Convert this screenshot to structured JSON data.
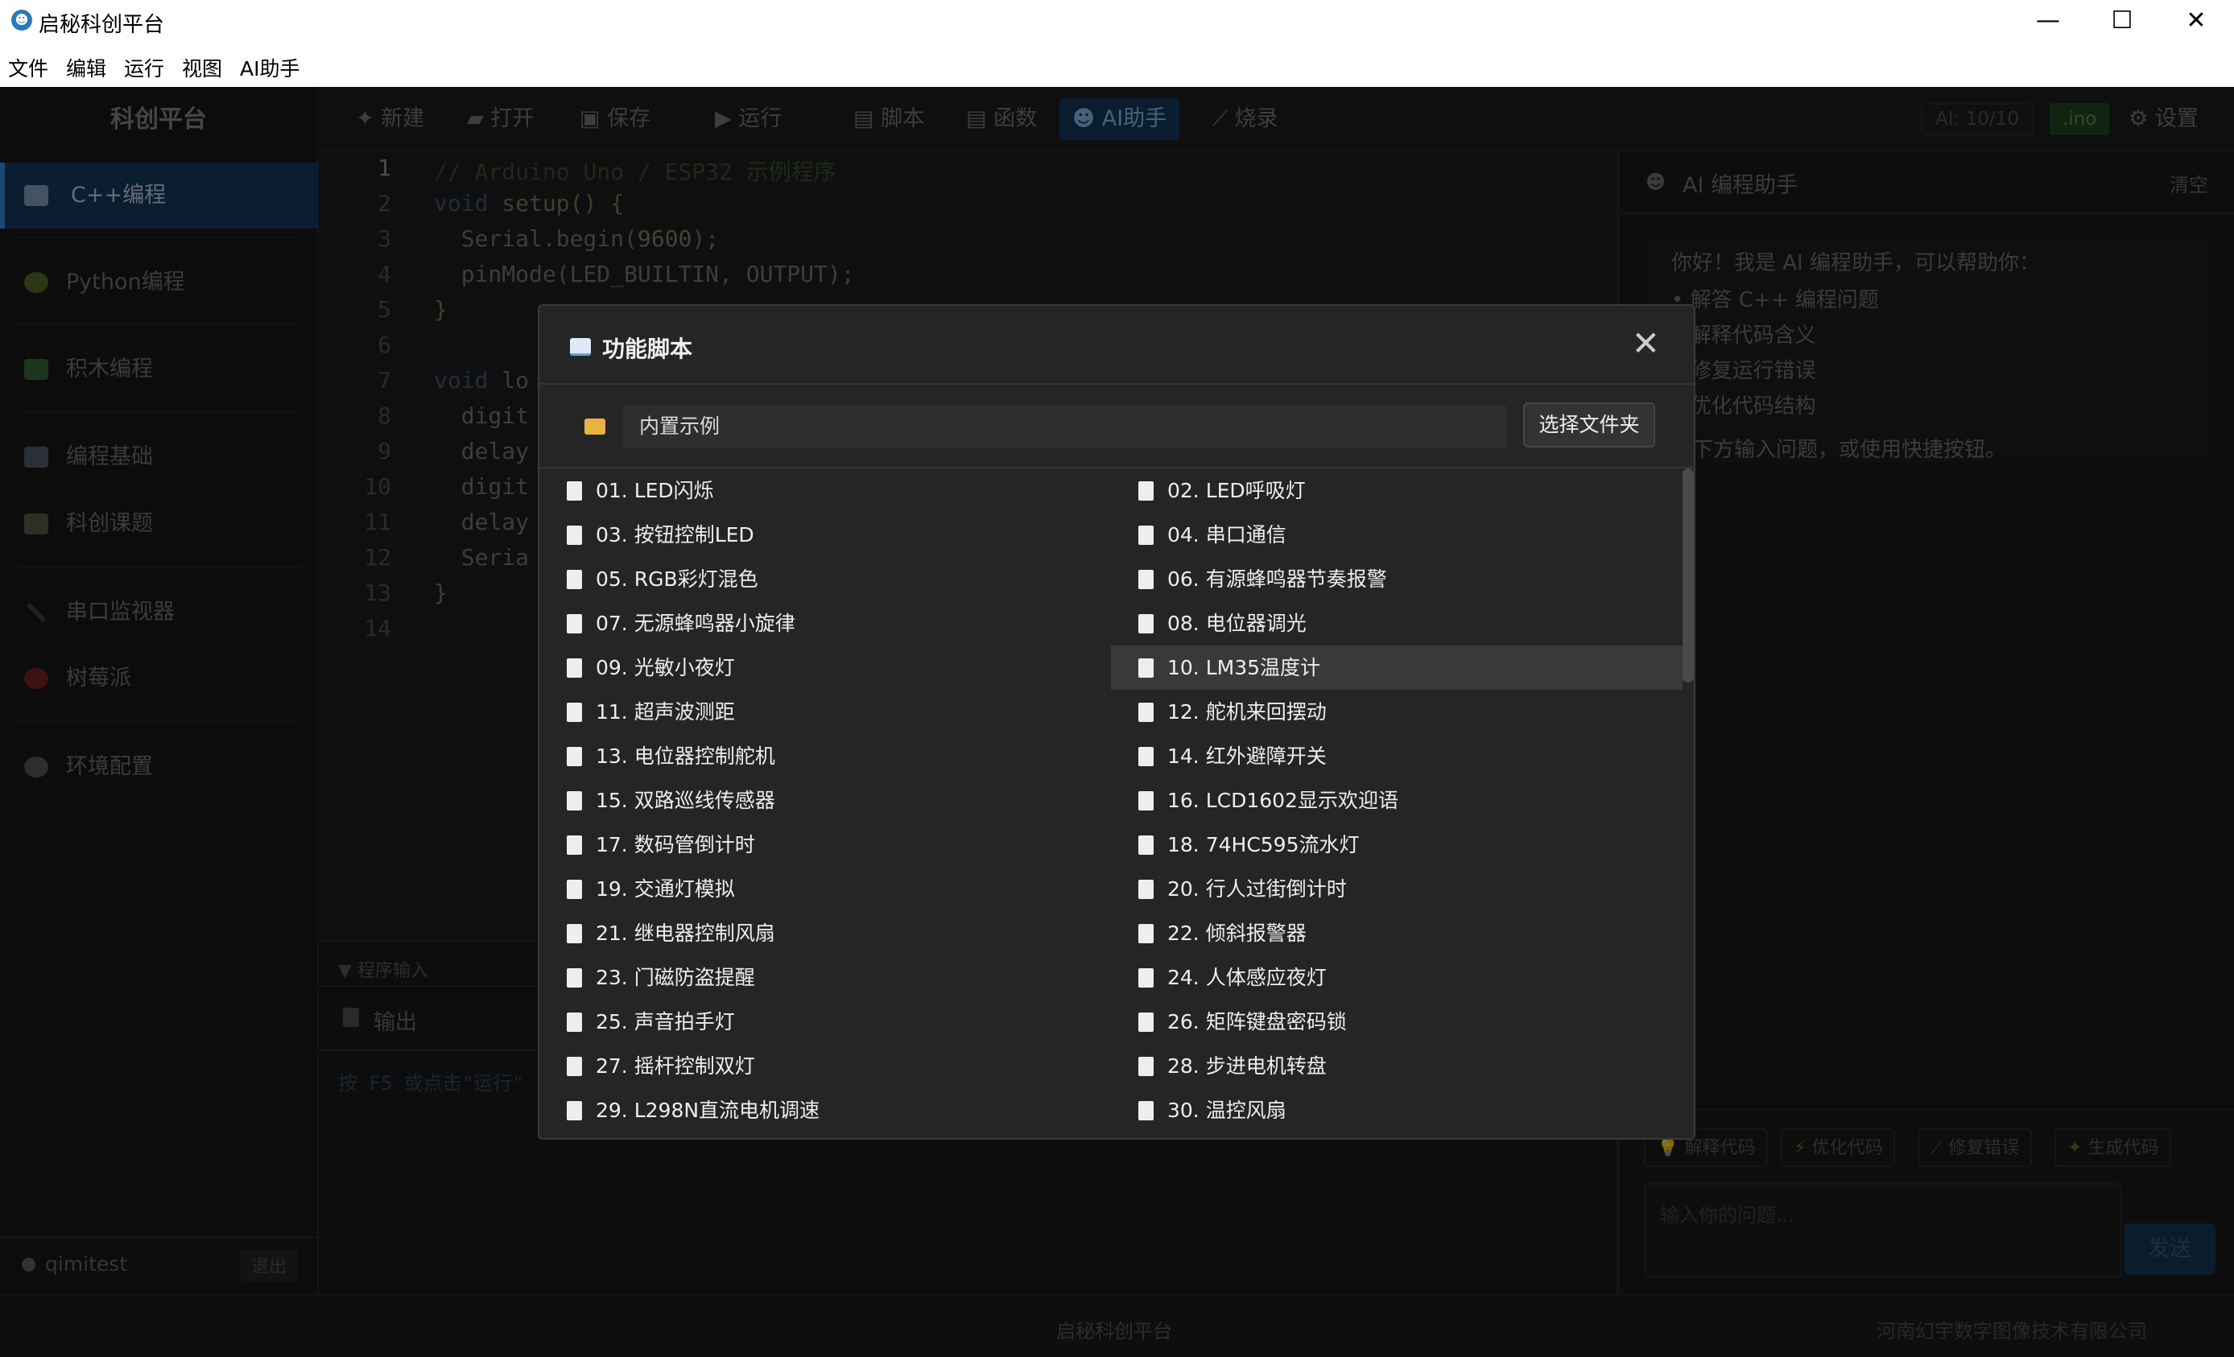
{
  "window": {
    "title": "启秘科创平台",
    "minimize": "—",
    "maximize": "☐",
    "close": "✕"
  },
  "menu": [
    "文件",
    "编辑",
    "运行",
    "视图",
    "AI助手"
  ],
  "sidebar": {
    "brand": "科创平台",
    "items": [
      "C++编程",
      "Python编程",
      "积木编程",
      "编程基础",
      "科创课题",
      "串口监视器",
      "树莓派",
      "环境配置"
    ],
    "user": "qimitest",
    "logout": "退出"
  },
  "toolbar": {
    "buttons": [
      "✦ 新建",
      "▰ 打开",
      "▣ 保存",
      "▶ 运行",
      "▤ 脚本",
      "▤ 函数",
      "AI助手",
      "⟋ 烧录"
    ],
    "ai_count": "AI: 10/10",
    "ext": ".ino",
    "settings": "⚙ 设置"
  },
  "editor": {
    "line_numbers": [
      "1",
      "2",
      "3",
      "4",
      "5",
      "6",
      "7",
      "8",
      "9",
      "10",
      "11",
      "12",
      "13",
      "14"
    ],
    "lines": {
      "l1": "// Arduino Uno / ESP32 示例程序",
      "l2_kw": "void",
      "l2_rest": " setup() {",
      "l3_a": "  Serial.begin(",
      "l3_num": "9600",
      "l3_b": ");",
      "l4": "  pinMode(LED_BUILTIN, OUTPUT);",
      "l5": "}",
      "l7_kw": "void",
      "l7_rest": " lo",
      "l8": "  digit",
      "l9": "  delay",
      "l10": "  digit",
      "l11": "  delay",
      "l12": "  Seria",
      "l13": "}"
    }
  },
  "output": {
    "input_section": "▼ 程序输入",
    "tab": "输出",
    "hint": "按 F5 或点击\"运行\""
  },
  "ai_panel": {
    "title": "AI 编程助手",
    "clear": "清空",
    "greeting": "你好！我是 AI 编程助手，可以帮助你：",
    "abilities": [
      "解答 C++ 编程问题",
      "解释代码含义",
      "修复运行错误",
      "优化代码结构"
    ],
    "footer_hint": "在下方输入问题，或使用快捷按钮。",
    "quick": [
      "解释代码",
      "优化代码",
      "修复错误",
      "生成代码"
    ],
    "input_placeholder": "输入你的问题...",
    "send": "发送"
  },
  "status": {
    "center": "启秘科创平台",
    "right": "河南幻宇数字图像技术有限公司"
  },
  "dialog": {
    "title": "功能脚本",
    "path": "内置示例",
    "choose_folder": "选择文件夹",
    "scripts": [
      "01. LED闪烁",
      "02. LED呼吸灯",
      "03. 按钮控制LED",
      "04. 串口通信",
      "05. RGB彩灯混色",
      "06. 有源蜂鸣器节奏报警",
      "07. 无源蜂鸣器小旋律",
      "08. 电位器调光",
      "09. 光敏小夜灯",
      "10. LM35温度计",
      "11. 超声波测距",
      "12. 舵机来回摆动",
      "13. 电位器控制舵机",
      "14. 红外避障开关",
      "15. 双路巡线传感器",
      "16. LCD1602显示欢迎语",
      "17. 数码管倒计时",
      "18. 74HC595流水灯",
      "19. 交通灯模拟",
      "20. 行人过街倒计时",
      "21. 继电器控制风扇",
      "22. 倾斜报警器",
      "23. 门磁防盗提醒",
      "24. 人体感应夜灯",
      "25. 声音拍手灯",
      "26. 矩阵键盘密码锁",
      "27. 摇杆控制双灯",
      "28. 步进电机转盘",
      "29. L298N直流电机调速",
      "30. 温控风扇"
    ],
    "highlighted": "10. LM35温度计"
  },
  "colors": {
    "accent": "#3a8ee6",
    "active_bg": "#163b62",
    "dialog_bg": "#252526"
  }
}
